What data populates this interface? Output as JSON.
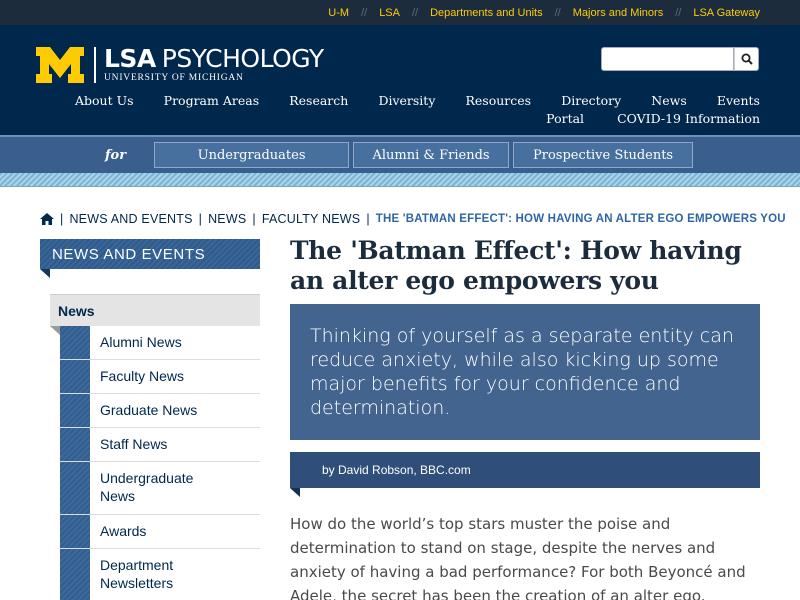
{
  "topbar": {
    "links": [
      "U-M",
      "LSA",
      "Departments and Units",
      "Majors and Minors",
      "LSA Gateway"
    ],
    "separator": "//"
  },
  "logo": {
    "lsa": "LSA",
    "dept": "PSYCHOLOGY",
    "sub": "UNIVERSITY OF MICHIGAN"
  },
  "search": {
    "placeholder": "",
    "value": ""
  },
  "nav": {
    "row1": [
      "About Us",
      "Program Areas",
      "Research",
      "Diversity",
      "Resources",
      "Directory",
      "News",
      "Events"
    ],
    "row2": [
      "Portal",
      "COVID-19 Information"
    ]
  },
  "audience": {
    "for_label": "for",
    "buttons": [
      "Undergraduates",
      "Alumni & Friends",
      "Prospective Students"
    ]
  },
  "breadcrumb": {
    "items": [
      "News and Events",
      "News",
      "Faculty News"
    ],
    "current": "THE 'BATMAN EFFECT': HOW HAVING AN ALTER EGO EMPOWERS YOU"
  },
  "sidebar": {
    "heading": "NEWS AND EVENTS",
    "active": "News",
    "items": [
      "Alumni News",
      "Faculty News",
      "Graduate News",
      "Staff News",
      "Undergraduate News",
      "Awards",
      "Department Newsletters"
    ]
  },
  "article": {
    "title": "The 'Batman Effect': How having an alter ego empowers you",
    "lede": "Thinking of yourself as a separate entity can reduce anxiety, while also kicking up some major benefits for your confidence and determination.",
    "byline": "by David Robson, BBC.com",
    "body": "How do the world’s top stars muster the poise and determination to stand on stage, despite the nerves and anxiety of having a bad performance? For both Beyoncé and Adele, the secret has been the creation of an alter ego."
  },
  "colors": {
    "maize": "#ffcb05",
    "blue": "#00274c",
    "accent": "#2f65a7"
  }
}
